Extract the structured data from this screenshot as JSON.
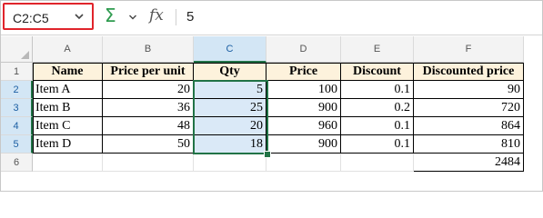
{
  "formula_bar": {
    "name_box": "C2:C5",
    "sigma_symbol": "Σ",
    "fx_symbol": "fx",
    "formula_value": "5"
  },
  "columns": [
    "A",
    "B",
    "C",
    "D",
    "E",
    "F"
  ],
  "selected_column": "C",
  "rows": [
    "1",
    "2",
    "3",
    "4",
    "5",
    "6"
  ],
  "selected_rows": [
    "2",
    "3",
    "4",
    "5"
  ],
  "sheet": {
    "headers": [
      "Name",
      "Price per unit",
      "Qty",
      "Price",
      "Discount",
      "Discounted price"
    ],
    "data": [
      [
        "Item A",
        "20",
        "5",
        "100",
        "0.1",
        "90"
      ],
      [
        "Item B",
        "36",
        "25",
        "900",
        "0.2",
        "720"
      ],
      [
        "Item C",
        "48",
        "20",
        "960",
        "0.1",
        "864"
      ],
      [
        "Item D",
        "50",
        "18",
        "900",
        "0.1",
        "810"
      ]
    ],
    "total": "2484"
  },
  "colors": {
    "name_box_border": "#e0242b",
    "selection": "#217346",
    "header_fill": "#fdf2dc",
    "selected_fill": "#dae9f7",
    "sigma": "#2e9b4f"
  }
}
